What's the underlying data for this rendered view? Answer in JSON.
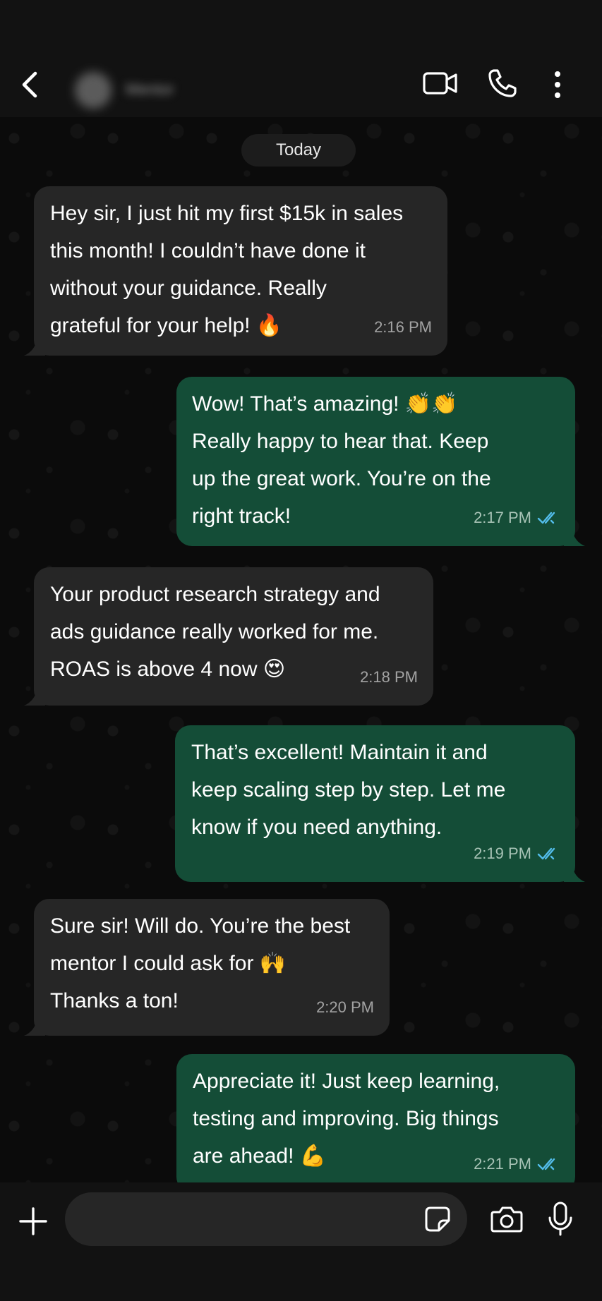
{
  "header": {
    "contact_name": "Mentor",
    "back_icon": "chevron-left-icon",
    "video_icon": "video-camera-icon",
    "call_icon": "phone-icon",
    "more_icon": "more-vertical-icon"
  },
  "chat": {
    "date_label": "Today",
    "messages": [
      {
        "direction": "incoming",
        "text": "Hey sir, I just hit my first $15k in sales\nthis month! I couldn’t have done it\nwithout your guidance. Really\ngrateful for your help!",
        "emoji": "🔥",
        "time": "2:16 PM"
      },
      {
        "direction": "outgoing",
        "text": "Wow! That’s amazing!\nReally happy to hear that. Keep\nup the great work. You’re on the\nright track!",
        "emoji": "👏👏",
        "time": "2:17 PM",
        "status": "read"
      },
      {
        "direction": "incoming",
        "text": "Your product research strategy and\nads guidance really worked for me.\nROAS is above 4 now",
        "emoji": "😍",
        "time": "2:18 PM"
      },
      {
        "direction": "outgoing",
        "text": "That’s excellent! Maintain it and\nkeep scaling step by step. Let me\nknow if you need anything.",
        "time": "2:19 PM",
        "status": "read"
      },
      {
        "direction": "incoming",
        "text_line1": "Sure sir! Will do. You’re the best",
        "text_line2": "mentor I could ask for",
        "text_line3": "Thanks a ton!",
        "emoji": "🙌",
        "time": "2:20 PM"
      },
      {
        "direction": "outgoing",
        "text_line1": "Appreciate it! Just keep learning,",
        "text_line2": "testing and improving. Big things",
        "text_line3": "are ahead!",
        "emoji": "💪",
        "time": "2:21 PM",
        "status": "read"
      }
    ]
  },
  "composer": {
    "input_value": "",
    "input_placeholder": "",
    "plus_icon": "plus-icon",
    "sticker_icon": "sticker-icon",
    "camera_icon": "camera-icon",
    "mic_icon": "microphone-icon"
  },
  "colors": {
    "incoming_bubble": "#262626",
    "outgoing_bubble": "#144d37",
    "read_ticks": "#53bdeb",
    "background": "#0b0b0b"
  }
}
